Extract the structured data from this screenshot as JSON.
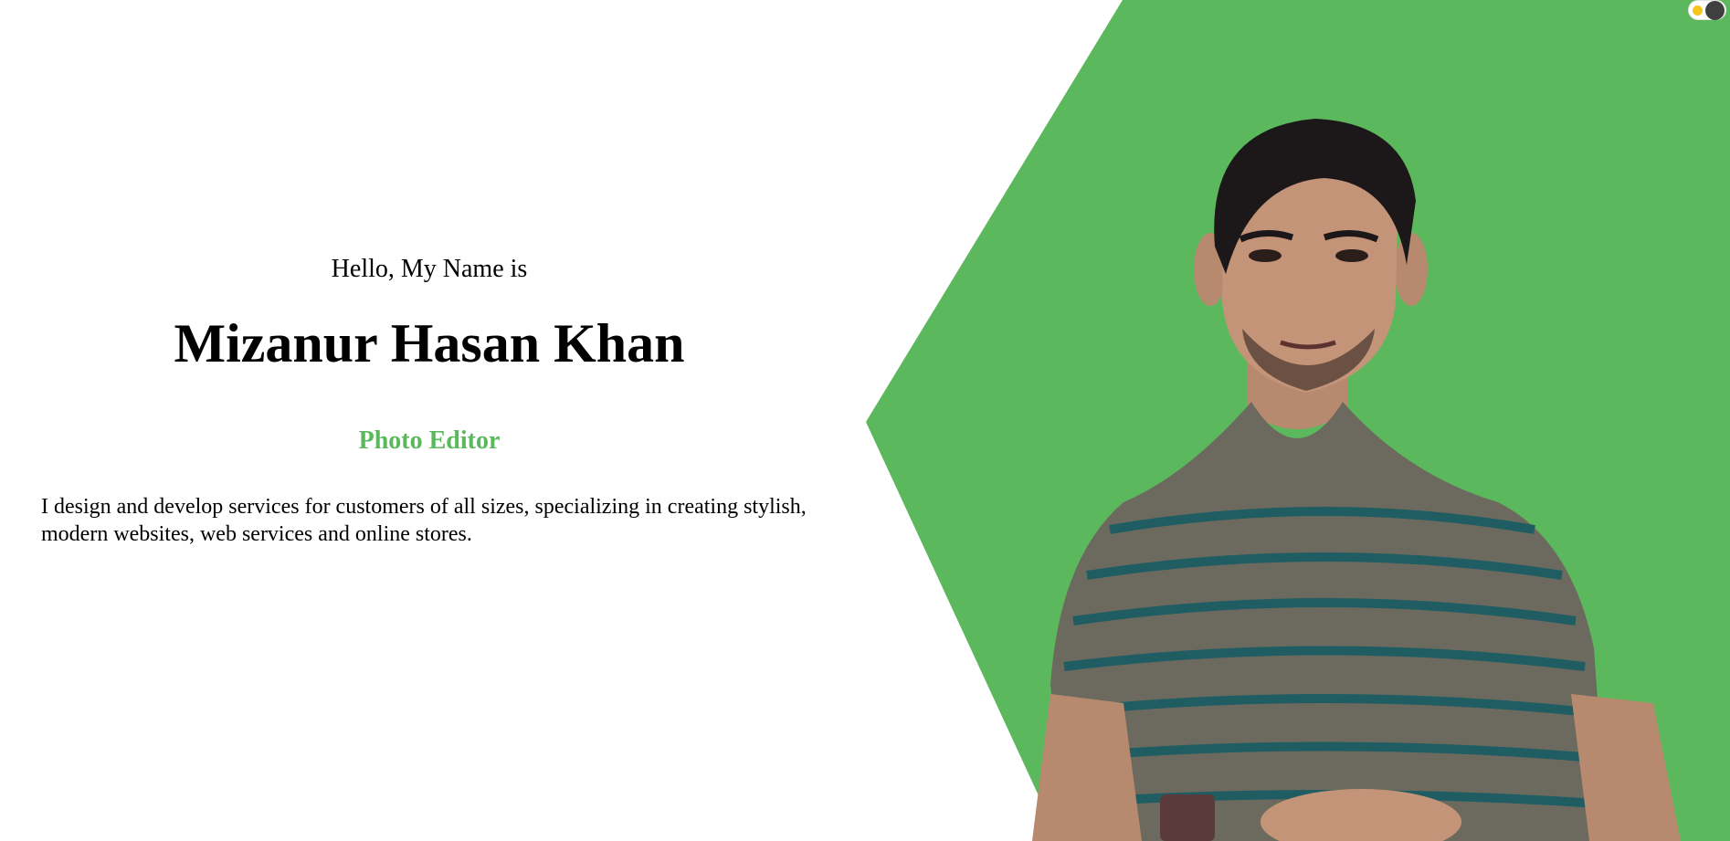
{
  "hero": {
    "greeting": "Hello, My Name is",
    "name": "Mizanur Hasan Khan",
    "role": "Photo Editor",
    "bio": "I design and develop services for customers of all sizes, specializing in creating stylish, modern websites, web services and online stores."
  },
  "portrait": {
    "alt": "Portrait of Mizanur Hasan Khan"
  },
  "theme_toggle": {
    "icon": "sun-icon",
    "state": "light"
  },
  "colors": {
    "accent": "#5cb85c",
    "text": "#000000",
    "background": "#ffffff",
    "toggle_knob": "#3f3f3f",
    "toggle_sun": "#f5c518"
  }
}
